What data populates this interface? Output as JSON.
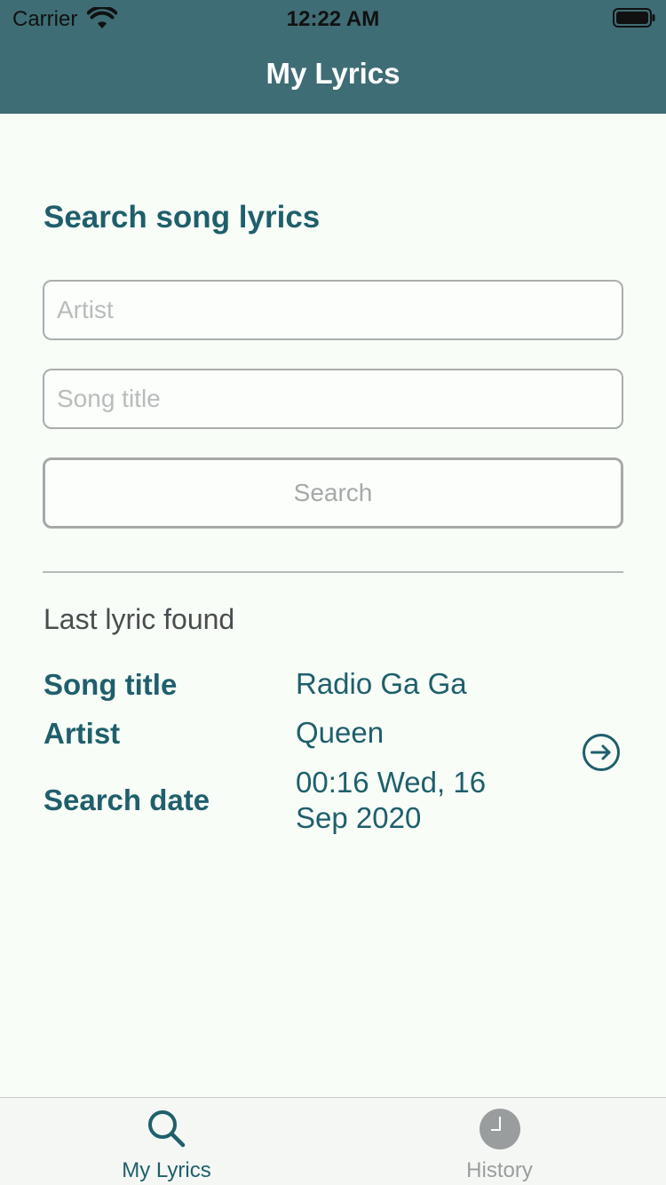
{
  "status_bar": {
    "carrier": "Carrier",
    "time": "12:22 AM"
  },
  "nav": {
    "title": "My Lyrics"
  },
  "search": {
    "heading": "Search song lyrics",
    "artist_placeholder": "Artist",
    "song_placeholder": "Song title",
    "button_label": "Search"
  },
  "last_found": {
    "heading": "Last lyric found",
    "song_label": "Song title",
    "song_value": "Radio Ga Ga",
    "artist_label": "Artist",
    "artist_value": "Queen",
    "date_label": "Search date",
    "date_value": "00:16 Wed, 16 Sep 2020",
    "open_icon": "arrow-right-circle-icon"
  },
  "tabs": [
    {
      "label": "My Lyrics",
      "icon": "search-icon",
      "selected": true
    },
    {
      "label": "History",
      "icon": "clock-icon",
      "selected": false
    }
  ],
  "colors": {
    "header": "#3f6d75",
    "accent": "#1f5f6b",
    "background": "#f8fdf8"
  }
}
